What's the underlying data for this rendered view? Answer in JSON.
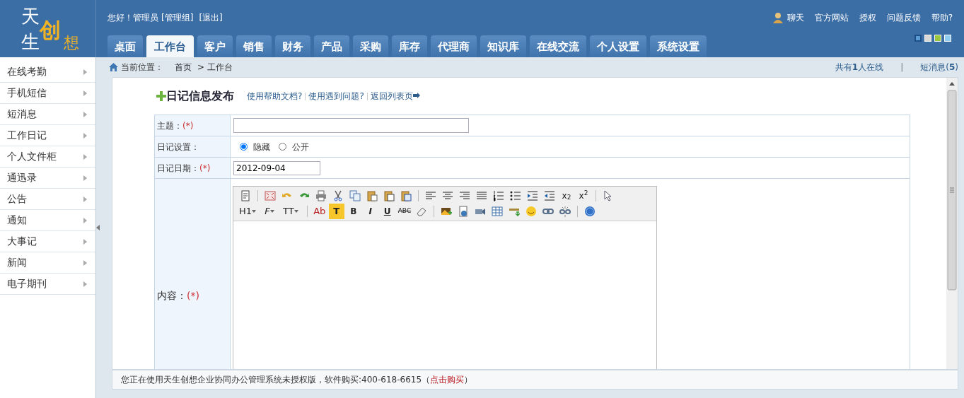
{
  "logo": {
    "top": "天",
    "bottom": "生",
    "badge": "创",
    "right": "想"
  },
  "header": {
    "greeting": "您好！管理员",
    "group": "[管理组]",
    "logout": "[退出]",
    "top_links": [
      "聊天",
      "官方网站",
      "授权",
      "问题反馈",
      "帮助?"
    ],
    "themes": [
      {
        "color": "#5b9bd5",
        "selected": true
      },
      {
        "color": "#d9d9d9",
        "selected": false
      },
      {
        "color": "#9cc63b",
        "selected": false
      },
      {
        "color": "#8fcdf0",
        "selected": false
      }
    ]
  },
  "tabs": [
    {
      "label": "桌面",
      "selected": false
    },
    {
      "label": "工作台",
      "selected": true
    },
    {
      "label": "客户",
      "selected": false
    },
    {
      "label": "销售",
      "selected": false
    },
    {
      "label": "财务",
      "selected": false
    },
    {
      "label": "产品",
      "selected": false
    },
    {
      "label": "采购",
      "selected": false
    },
    {
      "label": "库存",
      "selected": false
    },
    {
      "label": "代理商",
      "selected": false
    },
    {
      "label": "知识库",
      "selected": false
    },
    {
      "label": "在线交流",
      "selected": false
    },
    {
      "label": "个人设置",
      "selected": false
    },
    {
      "label": "系统设置",
      "selected": false
    }
  ],
  "sidebar": {
    "items": [
      "在线考勤",
      "手机短信",
      "短消息",
      "工作日记",
      "个人文件柜",
      "通迅录",
      "公告",
      "通知",
      "大事记",
      "新闻",
      "电子期刊"
    ]
  },
  "breadcrumb": {
    "label": "当前位置：",
    "items": [
      "首页",
      "工作台"
    ],
    "separator": ">"
  },
  "status": {
    "online": "共有**1**人在线",
    "divider": "|",
    "messages": "短消息(**5**)"
  },
  "form": {
    "title": "日记信息发布",
    "help_links": [
      "使用帮助文档?",
      "使用遇到问题?",
      "返回列表页"
    ],
    "fields": [
      {
        "kind": "text",
        "label": "主题：",
        "required": "(*)"
      },
      {
        "kind": "radio",
        "label": "日记设置：",
        "options": [
          {
            "label": "隐藏",
            "selected": true
          },
          {
            "label": "公开",
            "selected": false
          }
        ]
      },
      {
        "kind": "date",
        "label": "日记日期：",
        "required": "(*)",
        "value": "2012-09-04"
      },
      {
        "kind": "editor",
        "label": "内容：",
        "required": "(*)",
        "toolbar": [
          [
            {
              "kind": "icon"
            },
            {
              "kind": "separator"
            },
            {
              "kind": "icon"
            },
            {
              "kind": "icon"
            },
            {
              "kind": "icon"
            },
            {
              "kind": "icon"
            },
            {
              "kind": "icon"
            },
            {
              "kind": "icon"
            },
            {
              "kind": "icon"
            },
            {
              "kind": "icon"
            },
            {
              "kind": "icon"
            },
            {
              "kind": "separator"
            },
            {
              "kind": "icon"
            },
            {
              "kind": "icon"
            },
            {
              "kind": "icon"
            },
            {
              "kind": "icon"
            },
            {
              "kind": "icon"
            },
            {
              "kind": "icon"
            },
            {
              "kind": "icon"
            },
            {
              "kind": "icon"
            },
            {
              "kind": "text",
              "label": "x$_{2}$"
            },
            {
              "kind": "text",
              "label": "x$^{2}$"
            },
            {
              "kind": "separator"
            },
            {
              "kind": "icon"
            }
          ],
          [
            {
              "kind": "dropdown",
              "label": "H1"
            },
            {
              "kind": "dropdown",
              "label": "F"
            },
            {
              "kind": "dropdown",
              "label": "TT"
            },
            {
              "kind": "separator"
            },
            {
              "kind": "color",
              "label": "Ab"
            },
            {
              "kind": "highlight",
              "label": "T"
            },
            {
              "kind": "bold",
              "label": "B"
            },
            {
              "kind": "italic",
              "label": "I"
            },
            {
              "kind": "underline",
              "label": "U"
            },
            {
              "kind": "strike",
              "label": "ABC"
            },
            {
              "kind": "icon"
            },
            {
              "kind": "separator"
            },
            {
              "kind": "icon"
            },
            {
              "kind": "icon"
            },
            {
              "kind": "icon"
            },
            {
              "kind": "icon"
            },
            {
              "kind": "icon"
            },
            {
              "kind": "icon"
            },
            {
              "kind": "icon"
            },
            {
              "kind": "icon"
            },
            {
              "kind": "separator"
            },
            {
              "kind": "icon"
            }
          ]
        ]
      }
    ]
  },
  "footer": {
    "notice": "您正在使用天生创想企业协同办公管理系统未授权版，软件购买:400-618-6615（",
    "buy_link": "点击购买",
    "notice_end": "）"
  }
}
